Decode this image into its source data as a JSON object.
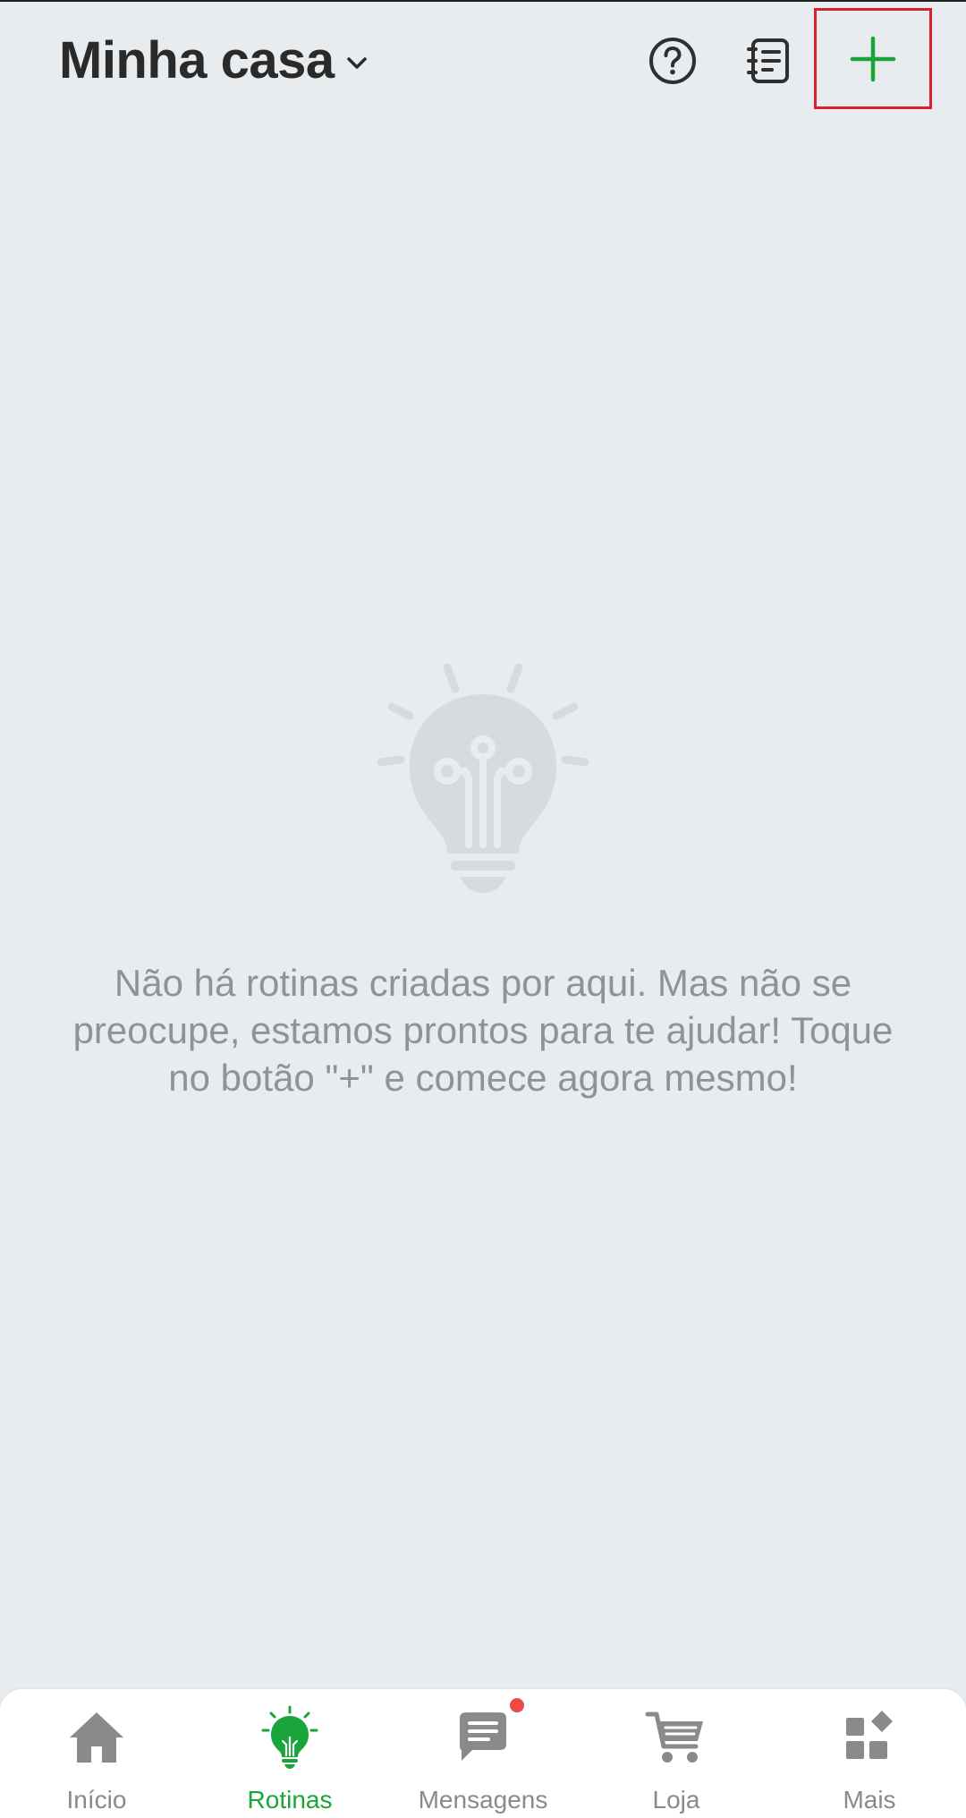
{
  "header": {
    "home_name": "Minha casa",
    "chevron_icon": "chevron-down-icon",
    "help_icon": "help-circle-icon",
    "log_icon": "notebook-log-icon",
    "add_icon": "plus-icon"
  },
  "empty_state": {
    "icon": "lightbulb-circuit-icon",
    "message": "Não há rotinas criadas por aqui. Mas não se preocupe, estamos prontos para te ajudar! Toque no botão \"+\" e comece agora mesmo!"
  },
  "tabbar": {
    "tabs": [
      {
        "label": "Início",
        "icon": "home-icon",
        "active": false
      },
      {
        "label": "Rotinas",
        "icon": "lightbulb-icon",
        "active": true
      },
      {
        "label": "Mensagens",
        "icon": "chat-bubble-icon",
        "active": false,
        "badge": true
      },
      {
        "label": "Loja",
        "icon": "shopping-cart-icon",
        "active": false
      },
      {
        "label": "Mais",
        "icon": "apps-grid-icon",
        "active": false
      }
    ]
  },
  "colors": {
    "background": "#e9ecee",
    "accent": "#1aa53a",
    "inactive": "#8a8a8a",
    "highlight_box": "#d8212f",
    "badge": "#ec4b4b"
  }
}
